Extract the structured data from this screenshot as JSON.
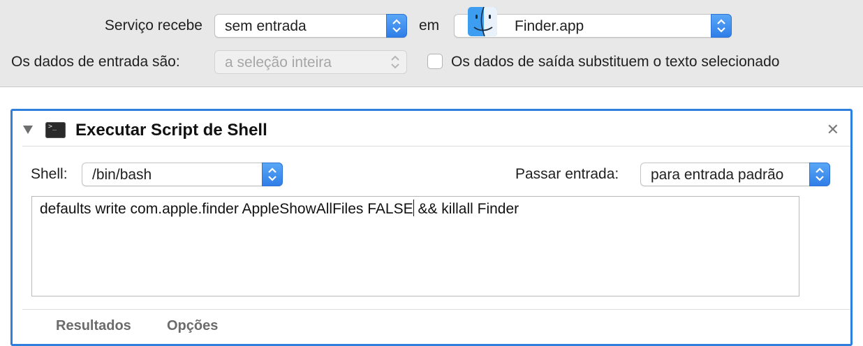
{
  "topbar": {
    "service_label": "Serviço recebe",
    "service_input": "sem entrada",
    "in_label": "em",
    "app": "Finder.app",
    "input_data_label": "Os dados de entrada são:",
    "input_data_value": "a seleção inteira",
    "replace_checkbox_label": "Os dados de saída substituem o texto selecionado",
    "replace_checked": false
  },
  "action": {
    "title": "Executar Script de Shell",
    "shell_label": "Shell:",
    "shell_value": "/bin/bash",
    "pass_input_label": "Passar entrada:",
    "pass_input_value": "para entrada padrão",
    "script_before_cursor": "defaults write com.apple.finder AppleShowAllFiles FALSE",
    "script_after_cursor": " && killall Finder",
    "tabs": [
      {
        "label": "Resultados"
      },
      {
        "label": "Opções"
      }
    ]
  },
  "colors": {
    "accent": "#2f7fdc",
    "stepper": "#3b87ee",
    "toolbar_bg": "#e8e8e8"
  },
  "icons": [
    "finder-icon",
    "terminal-icon",
    "disclosure-triangle-icon",
    "close-icon",
    "updown-chevron-icon"
  ]
}
